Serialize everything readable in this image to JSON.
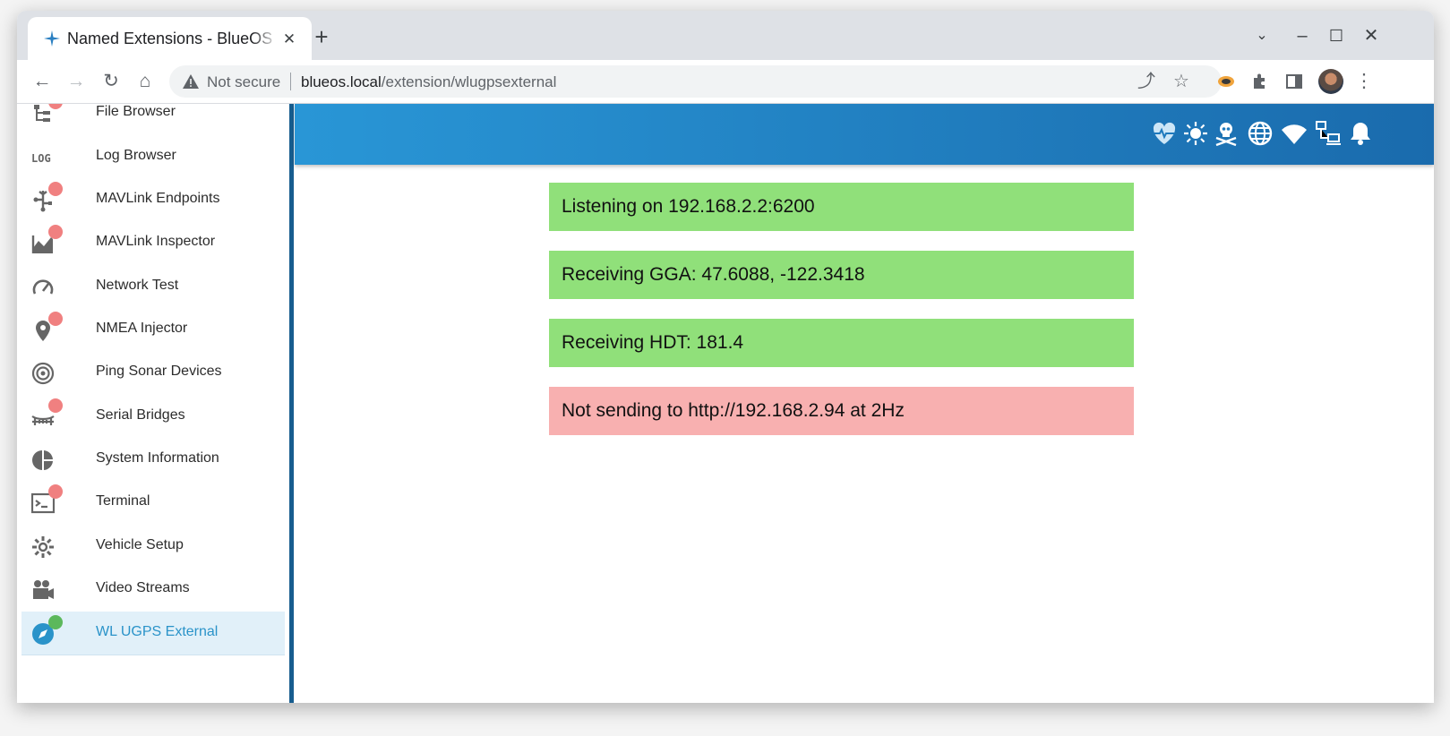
{
  "browser": {
    "tab_title": "Named Extensions - BlueOS",
    "not_secure_label": "Not secure",
    "url_host": "blueos.local",
    "url_path": "/extension/wlugpsexternal"
  },
  "sidebar": {
    "items": [
      {
        "label": "File Browser",
        "icon": "file-tree-icon",
        "badge": "red"
      },
      {
        "label": "Log Browser",
        "icon": "log-icon",
        "badge": null
      },
      {
        "label": "MAVLink Endpoints",
        "icon": "usb-endpoints-icon",
        "badge": "red"
      },
      {
        "label": "MAVLink Inspector",
        "icon": "chart-area-icon",
        "badge": "red"
      },
      {
        "label": "Network Test",
        "icon": "speedometer-icon",
        "badge": null
      },
      {
        "label": "NMEA Injector",
        "icon": "map-marker-icon",
        "badge": "red"
      },
      {
        "label": "Ping Sonar Devices",
        "icon": "sonar-icon",
        "badge": null
      },
      {
        "label": "Serial Bridges",
        "icon": "bridge-icon",
        "badge": "red"
      },
      {
        "label": "System Information",
        "icon": "chart-pie-icon",
        "badge": null
      },
      {
        "label": "Terminal",
        "icon": "terminal-icon",
        "badge": "red"
      },
      {
        "label": "Vehicle Setup",
        "icon": "gear-icon",
        "badge": null
      },
      {
        "label": "Video Streams",
        "icon": "video-camera-icon",
        "badge": null
      },
      {
        "label": "WL UGPS External",
        "icon": "compass-icon",
        "badge": "green"
      }
    ]
  },
  "appbar": {
    "icons": [
      "heart-pulse-icon",
      "brightness-icon",
      "skull-crossbones-icon",
      "globe-icon",
      "wifi-icon",
      "network-icon",
      "bell-icon"
    ]
  },
  "status_messages": [
    {
      "text": "Listening on 192.168.2.2:6200",
      "state": "ok"
    },
    {
      "text": "Receiving GGA: 47.6088, -122.3418",
      "state": "ok"
    },
    {
      "text": "Receiving HDT: 181.4",
      "state": "ok"
    },
    {
      "text": "Not sending to http://192.168.2.94 at 2Hz",
      "state": "error"
    }
  ],
  "colors": {
    "ok": "#90e07a",
    "error": "#f8b0b0",
    "appbar": "#2181c3",
    "active_item": "#2a93c9"
  }
}
